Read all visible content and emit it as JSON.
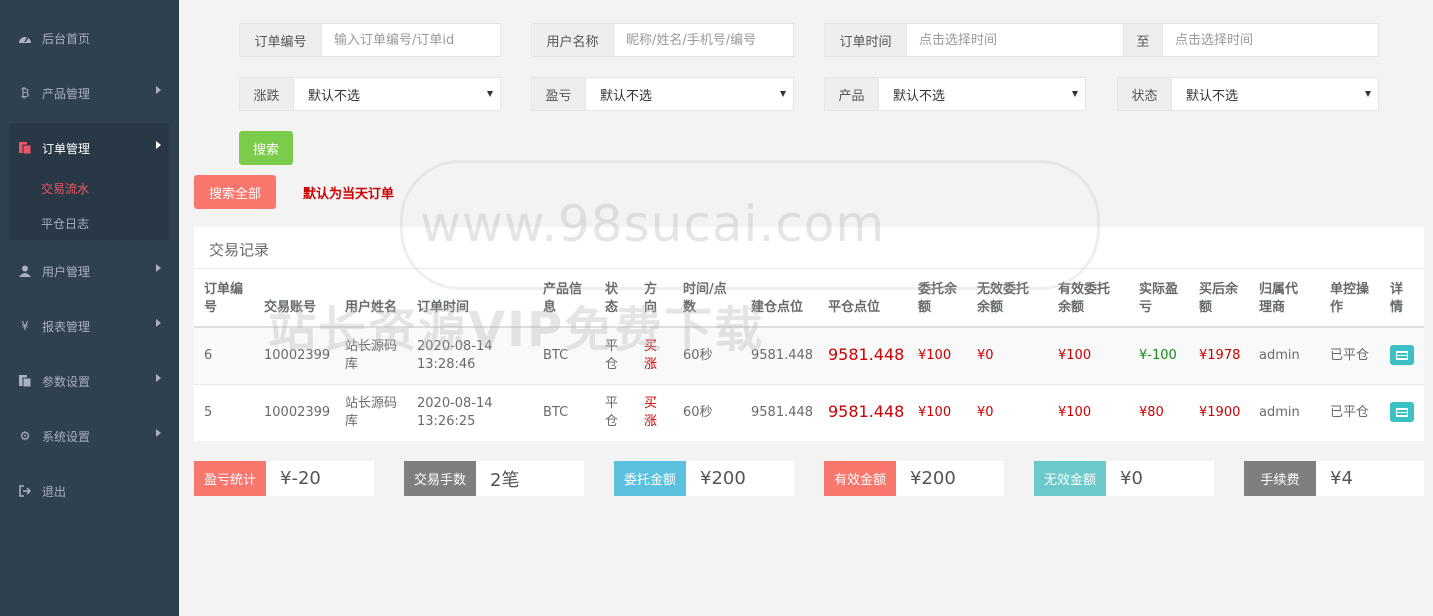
{
  "sidebar": {
    "items": [
      {
        "label": "后台首页",
        "icon": "dashboard-icon"
      },
      {
        "label": "产品管理",
        "icon": "bitcoin-icon"
      },
      {
        "label": "订单管理",
        "icon": "orders-icon"
      },
      {
        "label": "用户管理",
        "icon": "user-icon"
      },
      {
        "label": "报表管理",
        "icon": "yen-icon"
      },
      {
        "label": "参数设置",
        "icon": "document-icon"
      },
      {
        "label": "系统设置",
        "icon": "gears-icon"
      },
      {
        "label": "退出",
        "icon": "logout-icon"
      }
    ],
    "sub": [
      {
        "label": "交易流水"
      },
      {
        "label": "平仓日志"
      }
    ]
  },
  "filters": {
    "order_no": {
      "label": "订单编号",
      "placeholder": "输入订单编号/订单id"
    },
    "user_name": {
      "label": "用户名称",
      "placeholder": "昵称/姓名/手机号/编号"
    },
    "order_time": {
      "label": "订单时间",
      "placeholder": "点击选择时间",
      "to": "至",
      "placeholder2": "点击选择时间"
    },
    "rise_fall": {
      "label": "涨跌",
      "value": "默认不选"
    },
    "profit_loss": {
      "label": "盈亏",
      "value": "默认不选"
    },
    "product": {
      "label": "产品",
      "value": "默认不选"
    },
    "status": {
      "label": "状态",
      "value": "默认不选"
    }
  },
  "buttons": {
    "search": "搜索",
    "search_all": "搜索全部",
    "hint": "默认为当天订单"
  },
  "table": {
    "title": "交易记录",
    "headers": [
      "订单编号",
      "交易账号",
      "用户姓名",
      "订单时间",
      "产品信息",
      "状态",
      "方向",
      "时间/点数",
      "建仓点位",
      "平仓点位",
      "委托余额",
      "无效委托余额",
      "有效委托余额",
      "实际盈亏",
      "买后余额",
      "归属代理商",
      "单控操作",
      "详情"
    ],
    "rows": [
      {
        "id": "6",
        "account": "10002399",
        "name": "站长源码库",
        "date": "2020-08-14",
        "time": "13:28:46",
        "product": "BTC",
        "status": "平仓",
        "direction": "买涨",
        "duration": "60秒",
        "open": "9581.448",
        "close": "9581.448",
        "entrust": "¥100",
        "invalid": "¥0",
        "valid": "¥100",
        "pnl": "¥-100",
        "balance": "¥1978",
        "agent": "admin",
        "op": "已平仓"
      },
      {
        "id": "5",
        "account": "10002399",
        "name": "站长源码库",
        "date": "2020-08-14",
        "time": "13:26:25",
        "product": "BTC",
        "status": "平仓",
        "direction": "买涨",
        "duration": "60秒",
        "open": "9581.448",
        "close": "9581.448",
        "entrust": "¥100",
        "invalid": "¥0",
        "valid": "¥100",
        "pnl": "¥80",
        "balance": "¥1900",
        "agent": "admin",
        "op": "已平仓"
      }
    ]
  },
  "stats": [
    {
      "label": "盈亏统计",
      "value": "¥-20",
      "color": "#f8766c"
    },
    {
      "label": "交易手数",
      "value": "2笔",
      "color": "#7f7f7f"
    },
    {
      "label": "委托金额",
      "value": "¥200",
      "color": "#5bc0de"
    },
    {
      "label": "有效金额",
      "value": "¥200",
      "color": "#f8766c"
    },
    {
      "label": "无效金额",
      "value": "¥0",
      "color": "#6cc9c9"
    },
    {
      "label": "手续费",
      "value": "¥4",
      "color": "#7f7f7f"
    }
  ],
  "watermark": {
    "line1": "www.98sucai.com",
    "line2": "站长资源VIP免费下载"
  }
}
